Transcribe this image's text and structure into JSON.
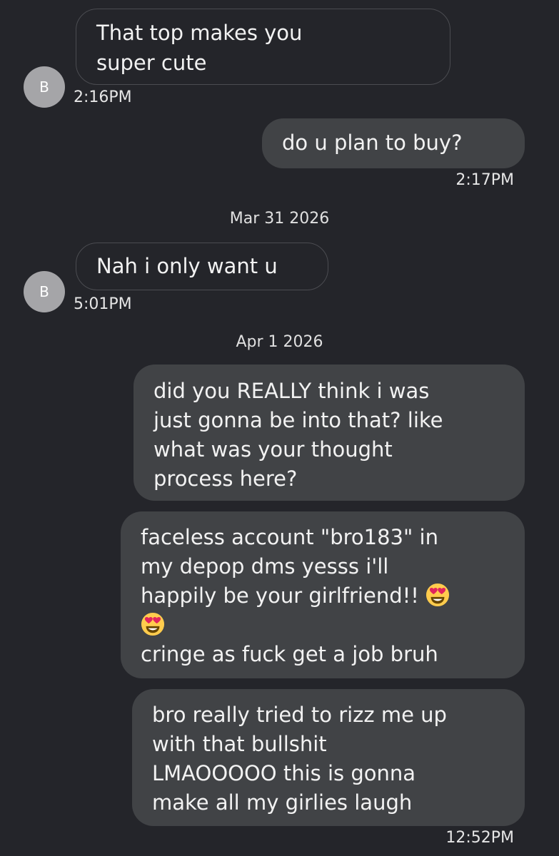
{
  "conversation": {
    "contact_initial": "B",
    "messages": [
      {
        "direction": "incoming",
        "lines": [
          "That top makes you",
          "super cute"
        ],
        "time": "2:16PM"
      },
      {
        "direction": "outgoing",
        "lines": [
          "do u plan to buy?"
        ],
        "time": "2:17PM"
      },
      {
        "date_separator": "Mar 31 2026"
      },
      {
        "direction": "incoming",
        "lines": [
          "Nah i only want u"
        ],
        "time": "5:01PM"
      },
      {
        "date_separator": "Apr 1 2026"
      },
      {
        "direction": "outgoing",
        "lines": [
          " did you REALLY think i was",
          "just gonna be into that? like",
          "what was your thought",
          "process here?"
        ]
      },
      {
        "direction": "outgoing",
        "lines": [
          "faceless account \"bro183\" in",
          "my depop dms yesss i'll",
          "happily be your girlfriend!! ",
          "",
          "cringe as fuck get a job bruh"
        ],
        "emoji": "smiling-face-with-heart-eyes"
      },
      {
        "direction": "outgoing",
        "lines": [
          "bro really tried to rizz me up",
          "with that bullshit",
          "LMAOOOOO this is gonna",
          "make all my girlies laugh"
        ],
        "time": "12:52PM"
      }
    ]
  },
  "colors": {
    "background": "#24252a",
    "incoming_bubble_border": "#4b4c51",
    "outgoing_bubble": "#414346",
    "avatar": "#a5a5a8",
    "text": "#f2f2f2"
  }
}
